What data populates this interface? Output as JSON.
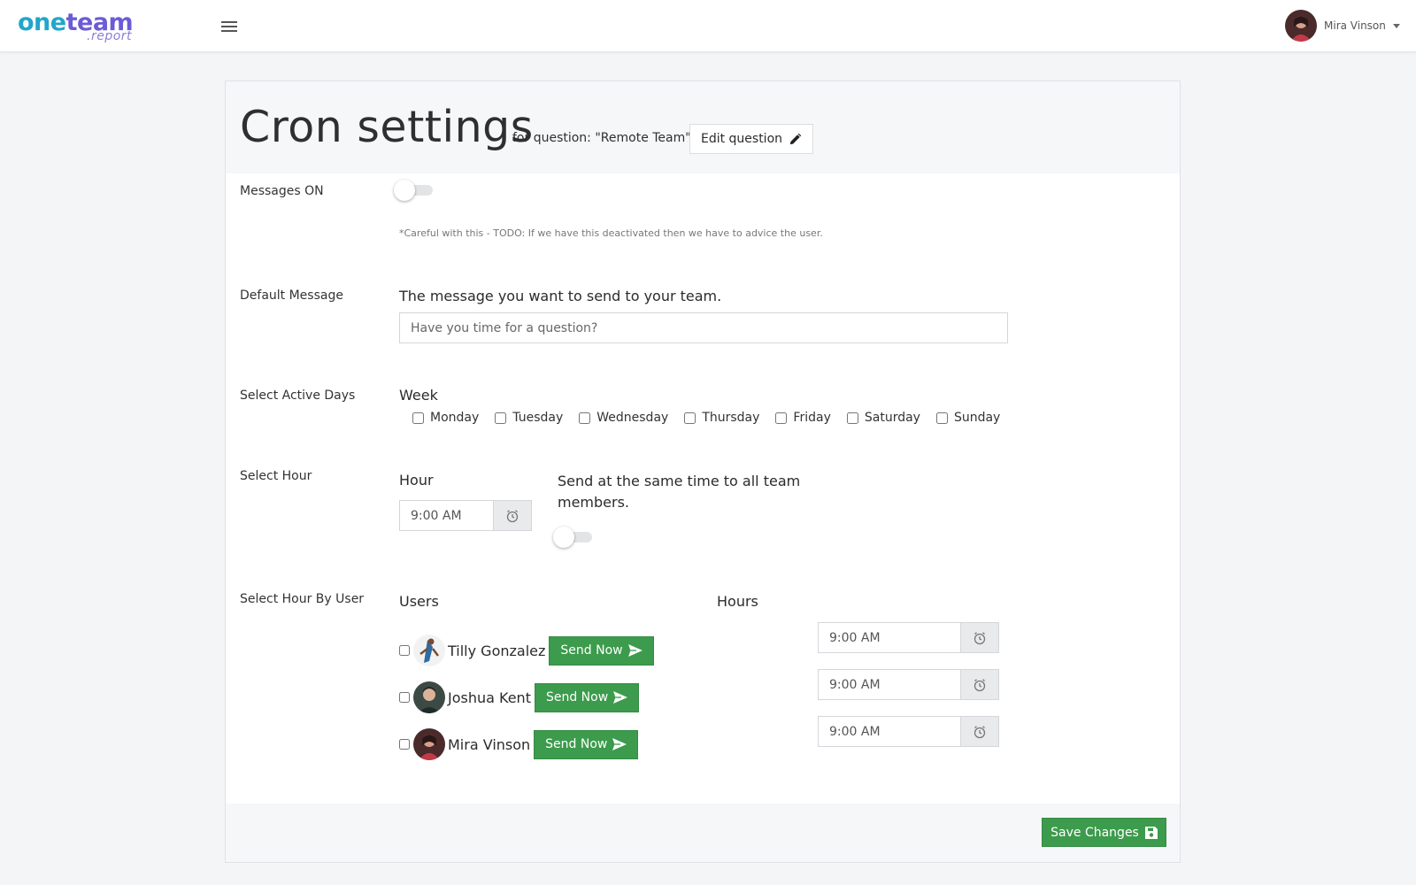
{
  "brand": {
    "name_part1": "one",
    "name_part2": "team",
    "sub": ".report",
    "color_primary": "#22a6c9",
    "color_secondary": "#6b5bd6"
  },
  "header": {
    "user_name": "Mira Vinson",
    "menu_icon": "hamburger-icon"
  },
  "page": {
    "title": "Cron settings",
    "subtitle": "for question: \"Remote Team\"",
    "edit_button": "Edit question"
  },
  "messages_on": {
    "label": "Messages ON",
    "enabled": false,
    "note": "*Careful with this - TODO: If we have this deactivated then we have to advice the user."
  },
  "default_message": {
    "label": "Default Message",
    "heading": "The message you want to send to your team.",
    "placeholder": "Have you time for a question?"
  },
  "active_days": {
    "label": "Select Active Days",
    "heading": "Week",
    "days": [
      "Monday",
      "Tuesday",
      "Wednesday",
      "Thursday",
      "Friday",
      "Saturday",
      "Sunday"
    ]
  },
  "select_hour": {
    "label": "Select Hour",
    "heading": "Hour",
    "value": "9:00 AM",
    "same_time_label": "Send at the same time to all team members.",
    "same_time_enabled": false
  },
  "hour_by_user": {
    "label": "Select Hour By User",
    "users_heading": "Users",
    "hours_heading": "Hours",
    "send_label": "Send Now",
    "users": [
      {
        "name": "Tilly Gonzalez",
        "hour": "9:00 AM"
      },
      {
        "name": "Joshua Kent",
        "hour": "9:00 AM"
      },
      {
        "name": "Mira Vinson",
        "hour": "9:00 AM"
      }
    ]
  },
  "footer": {
    "save_label": "Save Changes",
    "accent": "#3c9b4c"
  }
}
